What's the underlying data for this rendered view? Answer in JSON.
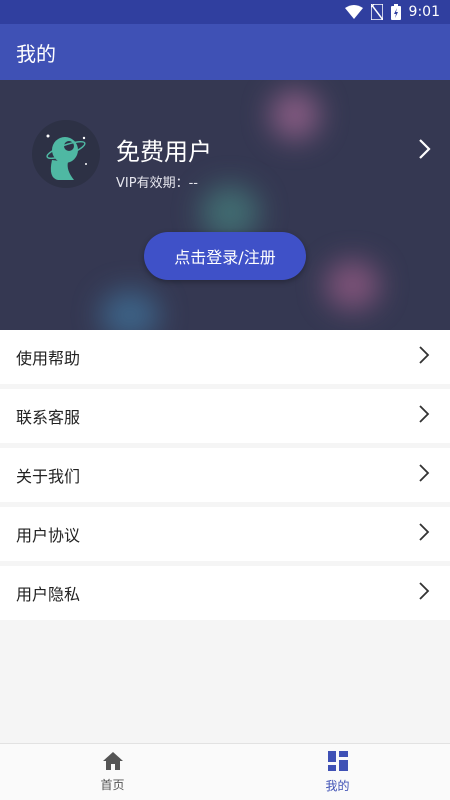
{
  "status_bar": {
    "time": "9:01",
    "icons": [
      "wifi-icon",
      "no-sim-icon",
      "battery-icon"
    ]
  },
  "app_bar": {
    "title": "我的"
  },
  "profile": {
    "user_name": "免费用户",
    "vip_label": "VIP有效期：",
    "vip_value": "--",
    "login_button": "点击登录/注册"
  },
  "menu": {
    "items": [
      {
        "label": "使用帮助"
      },
      {
        "label": "联系客服"
      },
      {
        "label": "关于我们"
      },
      {
        "label": "用户协议"
      },
      {
        "label": "用户隐私"
      }
    ]
  },
  "bottom_nav": {
    "tabs": [
      {
        "label": "首页",
        "icon": "home-icon",
        "active": false
      },
      {
        "label": "我的",
        "icon": "dashboard-icon",
        "active": true
      }
    ]
  },
  "colors": {
    "accent": "#3f51b5",
    "status_bar": "#303f9f",
    "profile_bg": "#353852",
    "login_button": "#3f51c8",
    "active_tab": "#3f51b5",
    "inactive_tab": "#555555"
  }
}
